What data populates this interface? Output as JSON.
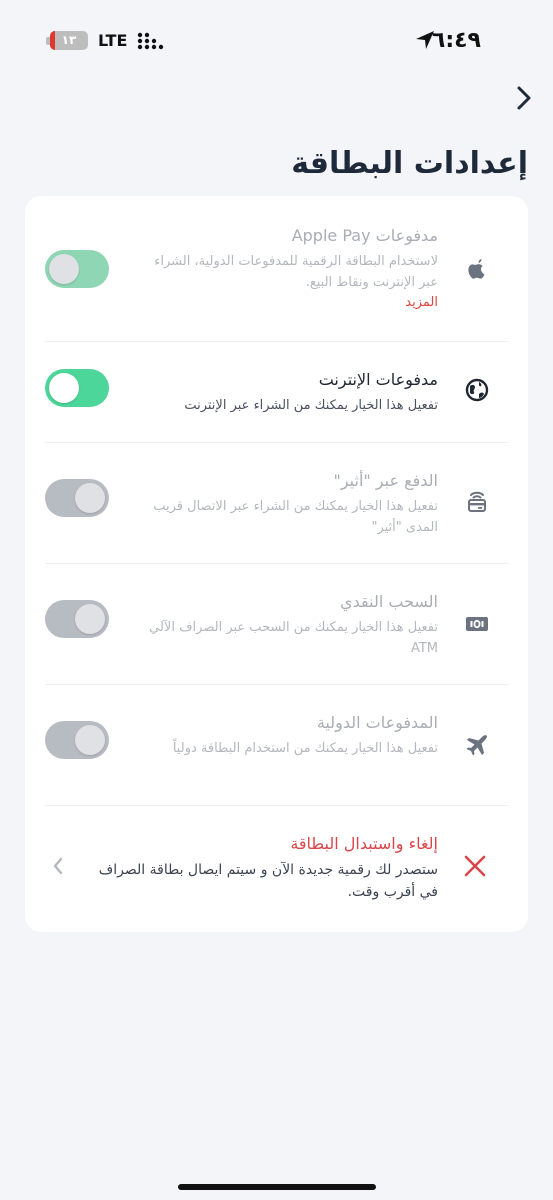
{
  "status_bar": {
    "time": "٦:٤٩",
    "battery": "١٣",
    "battery_level": 0.13,
    "network": "LTE"
  },
  "page": {
    "title": "إعدادات البطاقة"
  },
  "settings": [
    {
      "id": "apple-pay",
      "icon": "apple-icon",
      "title": "مدفوعات Apple Pay",
      "description": "لاستخدام البطاقة الرقمية للمدفوعات الدولية، الشراء عبر الإنترنت ونقاط البيع.",
      "more": "المزيد",
      "state": "on-dim"
    },
    {
      "id": "online-payments",
      "icon": "globe-icon",
      "title": "مدفوعات الإنترنت",
      "description": "تفعيل هذا الخيار يمكنك من الشراء عبر الإنترنت",
      "state": "on"
    },
    {
      "id": "atheer",
      "icon": "contactless-card-icon",
      "title": "الدفع عبر \"أثير\"",
      "description": "تفعيل هذا الخيار يمكنك من الشراء عبر الاتصال قريب المدى \"أثير\"",
      "state": "off"
    },
    {
      "id": "cash-withdrawal",
      "icon": "cash-icon",
      "title": "السحب النقدي",
      "description": "تفعيل هذا الخيار يمكنك من السحب عبر الصراف الآلي ATM",
      "state": "off"
    },
    {
      "id": "international",
      "icon": "airplane-icon",
      "title": "المدفوعات الدولية",
      "description": "تفعيل هذا الخيار يمكنك من استخدام البطاقة دولياً",
      "state": "off"
    }
  ],
  "cancel": {
    "title": "إلغاء واستبدال البطاقة",
    "description": "ستصدر لك رقمية جديدة الآن و سيتم ايصال بطاقة الصراف في أقرب وقت."
  },
  "colors": {
    "accent_green": "#4dd69a",
    "danger": "#d9464a",
    "title": "#1e2a3a"
  }
}
